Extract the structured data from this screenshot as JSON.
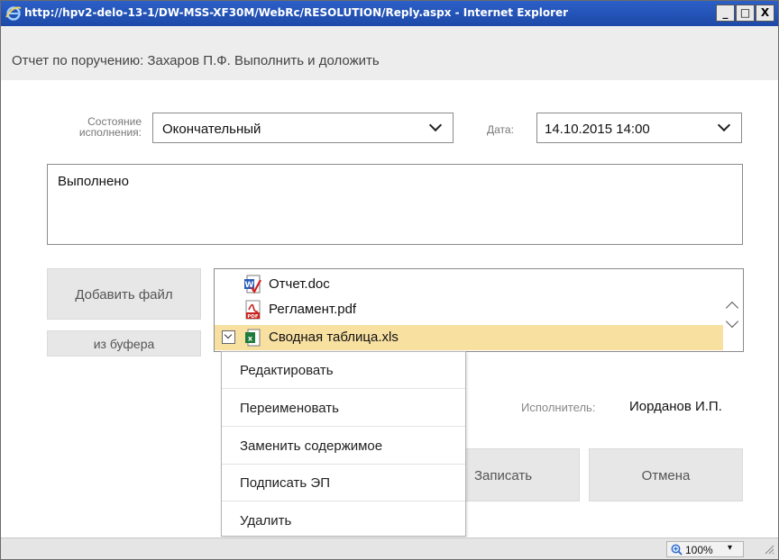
{
  "window": {
    "title": "http://hpv2-delo-13-1/DW-MSS-XF30M/WebRc/RESOLUTION/Reply.aspx - Internet Explorer",
    "minimize": "_",
    "maximize": "□",
    "close": "X"
  },
  "dialog": {
    "header": "Отчет по поручению: Захаров П.Ф. Выполнить и доложить"
  },
  "form": {
    "state_label": "Состояние исполнения:",
    "state_value": "Окончательный",
    "date_label": "Дата:",
    "date_value": "14.10.2015 14:00",
    "comment_value": "Выполнено"
  },
  "files": {
    "add_button": "Добавить файл",
    "clipboard_button": "из буфера",
    "items": [
      {
        "name": "Отчет.doc",
        "icon": "word-doc-icon"
      },
      {
        "name": "Регламент.pdf",
        "icon": "pdf-icon"
      },
      {
        "name": "Сводная таблица.xls",
        "icon": "excel-icon",
        "selected": true
      }
    ]
  },
  "context_menu": {
    "items": [
      "Редактировать",
      "Переименовать",
      "Заменить содержимое",
      "Подписать ЭП",
      "Удалить"
    ]
  },
  "executor": {
    "label": "Исполнитель:",
    "name": "Иорданов И.П."
  },
  "actions": {
    "save": "Записать",
    "cancel": "Отмена"
  },
  "statusbar": {
    "zoom": "100%",
    "zoom_arrow": "▾"
  },
  "colors": {
    "titlebar": "#2b5fc7",
    "selected_row": "#f8e0a1",
    "button_bg": "#e7e7e7",
    "header_bg": "#ededed"
  }
}
